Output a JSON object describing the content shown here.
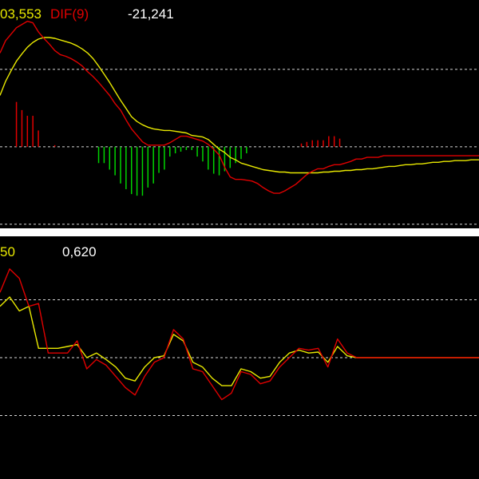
{
  "colors": {
    "background": "#000000",
    "yellow": "#e8e800",
    "red": "#e00000",
    "green": "#00d400",
    "white": "#ffffff",
    "grid": "#d8d8d8"
  },
  "macd_panel": {
    "legend": {
      "value_1": "03,553",
      "dif_label": "DIF(9)",
      "hist_value": "-21,241"
    }
  },
  "osc_panel": {
    "legend": {
      "value_1": "50",
      "value_2": "0,620"
    }
  },
  "chart_data": [
    {
      "type": "line",
      "name": "macd",
      "x": [
        0,
        1,
        2,
        3,
        4,
        5,
        6,
        7,
        8,
        9,
        10,
        11,
        12,
        13,
        14,
        15,
        16,
        17,
        18,
        19,
        20,
        21,
        22,
        23,
        24,
        25,
        26,
        27,
        28,
        29,
        30,
        31,
        32,
        33,
        34,
        35,
        36,
        37,
        38,
        39,
        40,
        41,
        42,
        43,
        44,
        45,
        46,
        47,
        48,
        49,
        50,
        51,
        52,
        53,
        54,
        55,
        56,
        57,
        58,
        59,
        60,
        61,
        62,
        63,
        64,
        65,
        66,
        67,
        68,
        69,
        70,
        71,
        72,
        73,
        74,
        75,
        76,
        77,
        78,
        79,
        80,
        81,
        82,
        83,
        84,
        85,
        86,
        87,
        88
      ],
      "ylim": [
        -100,
        180
      ],
      "grid_levels": [
        95,
        0,
        -95
      ],
      "series": [
        {
          "color": "red",
          "values": [
            115,
            130,
            138,
            146,
            150,
            154,
            152,
            141,
            133,
            126,
            118,
            113,
            111,
            108,
            104,
            99,
            92,
            86,
            79,
            71,
            63,
            53,
            45,
            33,
            22,
            14,
            6,
            2,
            2,
            2,
            2,
            5,
            9,
            13,
            13,
            11,
            9,
            7,
            3,
            -3,
            -10,
            -25,
            -37,
            -40,
            -40,
            -41,
            -42,
            -45,
            -50,
            -54,
            -57,
            -57,
            -54,
            -50,
            -46,
            -40,
            -34,
            -30,
            -27,
            -27,
            -24,
            -22,
            -22,
            -20,
            -18,
            -15,
            -15,
            -13,
            -13,
            -13,
            -11,
            -11,
            -11,
            -11,
            -11,
            -11,
            -11,
            -11,
            -11,
            -11,
            -11,
            -11,
            -11,
            -11,
            -11,
            -11,
            -11,
            -11,
            -11
          ]
        },
        {
          "color": "yellow",
          "values": [
            63,
            80,
            93,
            105,
            114,
            122,
            128,
            132,
            134,
            134,
            133,
            131,
            129,
            127,
            124,
            120,
            115,
            108,
            99,
            89,
            79,
            68,
            57,
            47,
            37,
            31,
            27,
            24,
            22,
            21,
            20,
            20,
            19,
            18,
            17,
            14,
            13,
            12,
            9,
            3,
            -3,
            -7,
            -13,
            -16,
            -20,
            -22,
            -24,
            -26,
            -28,
            -29,
            -30,
            -31,
            -31,
            -32,
            -32,
            -32,
            -32,
            -32,
            -32,
            -31,
            -31,
            -30,
            -30,
            -29,
            -29,
            -28,
            -28,
            -27,
            -27,
            -26,
            -25,
            -24,
            -24,
            -23,
            -22,
            -22,
            -21,
            -21,
            -20,
            -19,
            -19,
            -18,
            -18,
            -17,
            -17,
            -17,
            -16,
            -16,
            -16
          ]
        }
      ],
      "histogram": [
        0,
        0,
        0,
        55,
        45,
        38,
        38,
        20,
        0,
        0,
        2,
        0,
        0,
        0,
        0,
        0,
        0,
        0,
        -20,
        -20,
        -28,
        -35,
        -45,
        -52,
        -58,
        -60,
        -60,
        -50,
        -45,
        -32,
        -28,
        -12,
        -8,
        -6,
        -4,
        -4,
        -12,
        -18,
        -28,
        -33,
        -35,
        -30,
        -26,
        -20,
        -15,
        -8,
        0,
        0,
        0,
        0,
        0,
        0,
        0,
        0,
        0,
        4,
        6,
        8,
        8,
        8,
        13,
        13,
        10,
        0,
        0,
        0,
        0,
        0,
        0,
        0,
        0,
        0,
        0,
        0,
        0,
        0,
        0,
        0,
        0,
        0,
        0,
        0,
        0,
        0,
        0,
        0,
        0,
        0,
        0
      ],
      "xlabel": "",
      "ylabel": ""
    },
    {
      "type": "line",
      "name": "oscillator",
      "x": [
        0,
        1,
        2,
        3,
        4,
        5,
        6,
        7,
        8,
        9,
        10,
        11,
        12,
        13,
        14,
        15,
        16,
        17,
        18,
        19,
        20,
        21,
        22,
        23,
        24,
        25,
        26,
        27,
        28,
        29,
        30,
        31,
        32,
        33,
        34,
        35,
        36,
        37,
        38,
        39,
        40,
        41,
        42,
        43,
        44,
        45,
        46,
        47,
        48,
        49,
        50
      ],
      "ylim": [
        -1.3,
        1.3
      ],
      "grid_levels": [
        0.62,
        0,
        -0.62
      ],
      "series": [
        {
          "color": "red",
          "values": [
            0.7,
            0.95,
            0.85,
            0.55,
            0.58,
            0.05,
            0.05,
            0.05,
            0.18,
            -0.12,
            -0.02,
            -0.08,
            -0.2,
            -0.32,
            -0.4,
            -0.2,
            -0.05,
            0.0,
            0.3,
            0.2,
            -0.12,
            -0.15,
            -0.3,
            -0.45,
            -0.38,
            -0.15,
            -0.18,
            -0.28,
            -0.25,
            -0.1,
            0.0,
            0.1,
            0.08,
            0.1,
            -0.1,
            0.2,
            0.05,
            0.0,
            0.0,
            0.0,
            0.0,
            0.0,
            0.0,
            0.0,
            0.0,
            0.0,
            0.0,
            0.0,
            0.0,
            0.0,
            0.0
          ]
        },
        {
          "color": "yellow",
          "values": [
            0.55,
            0.65,
            0.5,
            0.55,
            0.1,
            0.1,
            0.1,
            0.12,
            0.14,
            0.0,
            0.05,
            -0.02,
            -0.1,
            -0.22,
            -0.25,
            -0.1,
            0.0,
            0.02,
            0.25,
            0.18,
            -0.05,
            -0.1,
            -0.22,
            -0.3,
            -0.3,
            -0.12,
            -0.15,
            -0.22,
            -0.2,
            -0.05,
            0.05,
            0.08,
            0.05,
            0.06,
            -0.05,
            0.12,
            0.02,
            0.0,
            0.0,
            0.0,
            0.0,
            0.0,
            0.0,
            0.0,
            0.0,
            0.0,
            0.0,
            0.0,
            0.0,
            0.0,
            0.0
          ]
        }
      ],
      "xlabel": "",
      "ylabel": ""
    }
  ]
}
